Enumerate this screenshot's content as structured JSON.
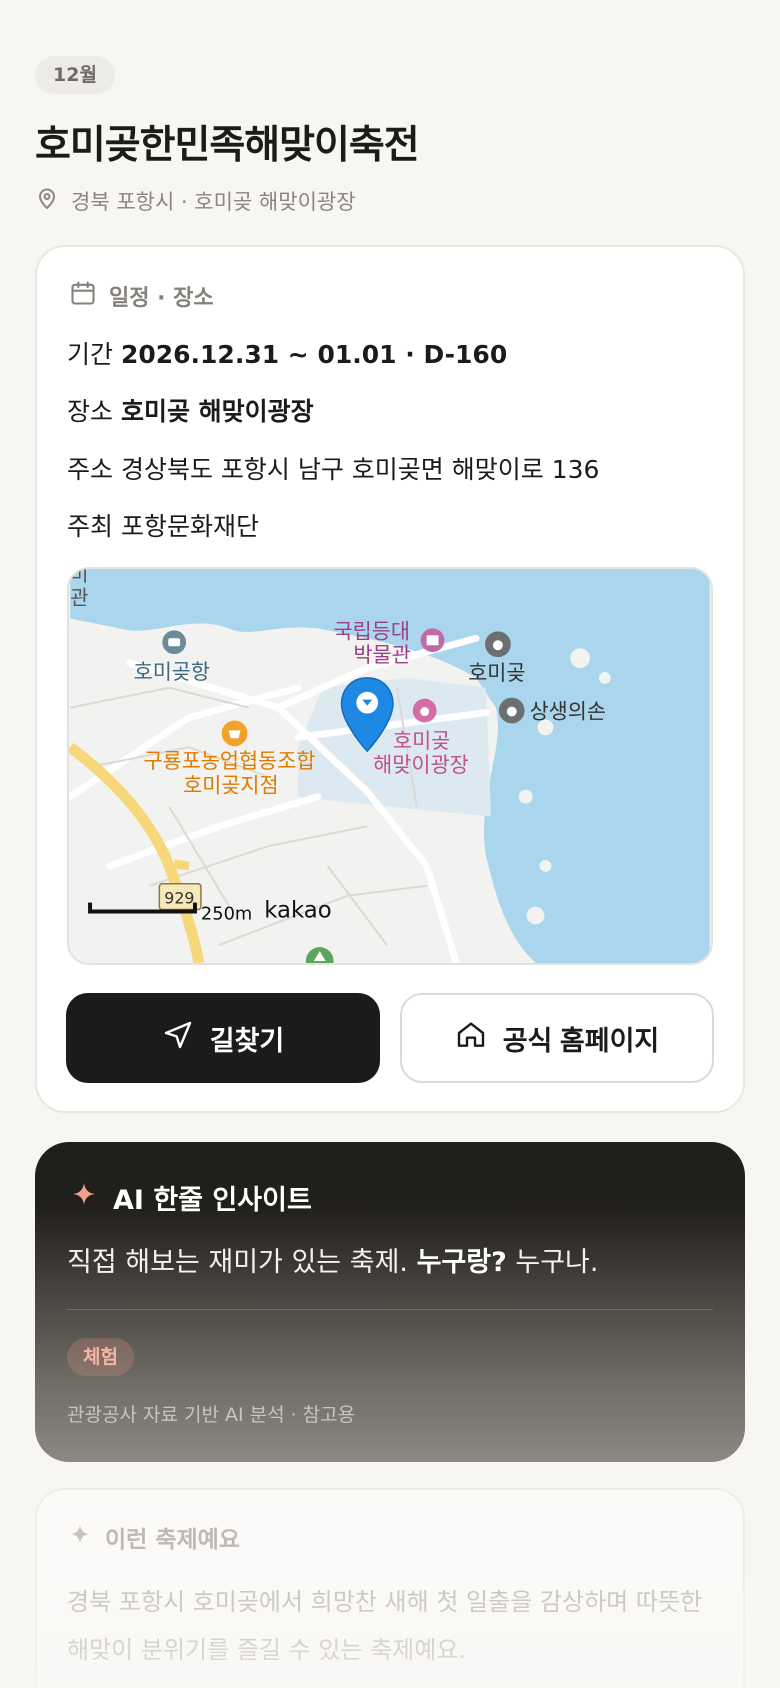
{
  "header": {
    "month_badge": "12월",
    "title": "호미곶한민족해맞이축전",
    "location": "경북 포항시 · 호미곶 해맞이광장",
    "location_icon": "map-pin-icon"
  },
  "schedule_card": {
    "heading": "일정 · 장소",
    "heading_icon": "calendar-icon",
    "period_label": "기간",
    "period_value": "2026.12.31 ~ 01.01 · D-160",
    "place_label": "장소",
    "place_value": "호미곶 해맞이광장",
    "address_label": "주소",
    "address_value": "경상북도 포항시 남구 호미곶면 해맞이로 136",
    "host_label": "주최",
    "host_value": "포항문화재단",
    "map": {
      "labels": {
        "top_left_1": "미",
        "top_left_2": "관",
        "museum_1": "국립등대",
        "museum_2": "박물관",
        "port": "호미곶항",
        "homigot": "호미곶",
        "sangsaeng": "상생의손",
        "plaza_1": "호미곶",
        "plaza_2": "해맞이광장",
        "coop_1": "구룡포농업협동조합",
        "coop_2": "호미곶지점",
        "route": "929",
        "scale": "250m",
        "provider": "kakao"
      },
      "colors": {
        "sea": "#a9d6ec",
        "land": "#f2f2f0",
        "pin": "#1e88e5",
        "poi_pink": "#c2508f",
        "poi_orange": "#e07b00"
      }
    },
    "directions_button": "길찾기",
    "directions_icon": "navigation-arrow-icon",
    "homepage_button": "공식 홈페이지",
    "homepage_icon": "home-icon"
  },
  "ai_card": {
    "heading": "AI 한줄 인사이트",
    "heading_icon": "sparkle-icon",
    "line_normal": "직접 해보는 재미가 있는 축제. ",
    "line_bold": "누구랑?",
    "line_tail": " 누구나.",
    "tag": "체험",
    "note": "관광공사 자료 기반 AI 분석 · 참고용"
  },
  "about_card": {
    "heading": "이런 축제예요",
    "heading_icon": "sparkle-icon",
    "text": "경북 포항시 호미곶에서 희망찬 새해 첫 일출을 감상하며 따뜻한 해맞이 분위기를 즐길 수 있는 축제예요."
  }
}
